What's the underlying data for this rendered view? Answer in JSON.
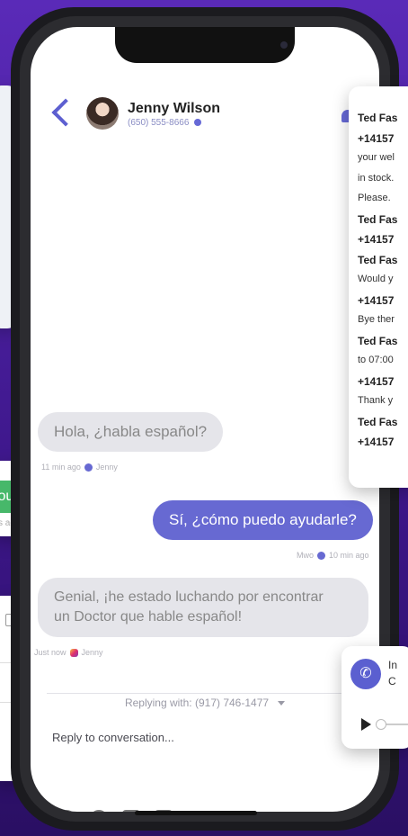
{
  "contact": {
    "name": "Jenny Wilson",
    "phone": "(650) 555-8666"
  },
  "messages": [
    {
      "text": "Hola, ¿habla español?",
      "meta": "11 min ago",
      "author": "Jenny",
      "direction": "in"
    },
    {
      "text": "Sí, ¿cómo puedo ayudarle?",
      "meta": "10 min ago",
      "author": "Mwo",
      "direction": "out"
    },
    {
      "text_line1": "Genial, ¡he estado luchando por encontrar",
      "text_line2": "un Doctor que hable español!",
      "meta": "Just now",
      "author": "Jenny",
      "direction": "in"
    }
  ],
  "composer": {
    "replying_prefix": "Replying with:",
    "replying_number": "(917) 746-1477",
    "placeholder": "Reply to conversation..."
  },
  "left_card": {
    "badge": "ours",
    "time": "s ago"
  },
  "right_card": {
    "lines": [
      {
        "text": "Ted Fas",
        "bold": true
      },
      {
        "text": "+14157",
        "bold": true
      },
      {
        "text": "your wel",
        "bold": false
      },
      {
        "text": "in stock.",
        "bold": false
      },
      {
        "text": "Please.",
        "bold": false
      },
      {
        "text": "Ted Fas",
        "bold": true
      },
      {
        "text": "+14157",
        "bold": true
      },
      {
        "text": "Ted Fas",
        "bold": true
      },
      {
        "text": "Would y",
        "bold": false
      },
      {
        "text": "+14157",
        "bold": true
      },
      {
        "text": "Bye ther",
        "bold": false
      },
      {
        "text": "Ted Fas",
        "bold": true
      },
      {
        "text": "to 07:00",
        "bold": false
      },
      {
        "text": "+14157",
        "bold": true
      },
      {
        "text": "Thank y",
        "bold": false
      },
      {
        "text": "Ted Fas",
        "bold": true
      },
      {
        "text": "+14157",
        "bold": true
      }
    ]
  },
  "call_card": {
    "line1": "In",
    "line2": "C"
  },
  "colors": {
    "accent": "#6769d2",
    "background": "#4a1fa3",
    "green": "#47b86a"
  }
}
